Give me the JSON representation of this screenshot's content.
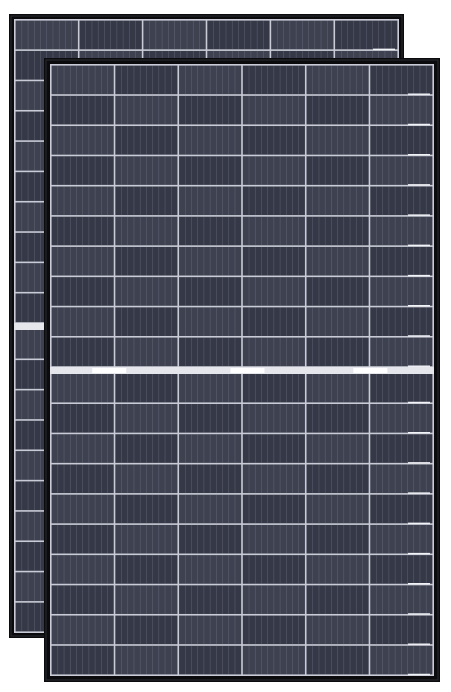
{
  "scene": {
    "subject": "solar-panels",
    "panel_count": 2,
    "panel_style": "half-cut monocrystalline, black frame"
  },
  "colors": {
    "background": "#ffffff",
    "frame": "#0b0b0d",
    "cell": "#3d4150",
    "cell_dark": "#353847",
    "grid_line": "#c9ccd6",
    "busbar": "#7c8090",
    "highlight": "#ffffff"
  },
  "panels": [
    {
      "id": "back",
      "label": "",
      "cell_columns": 6,
      "cell_rows": 20,
      "ribbon_lines_per_cell": 9
    },
    {
      "id": "front",
      "label": "",
      "cell_columns": 6,
      "cell_rows": 20,
      "ribbon_lines_per_cell": 9
    }
  ]
}
